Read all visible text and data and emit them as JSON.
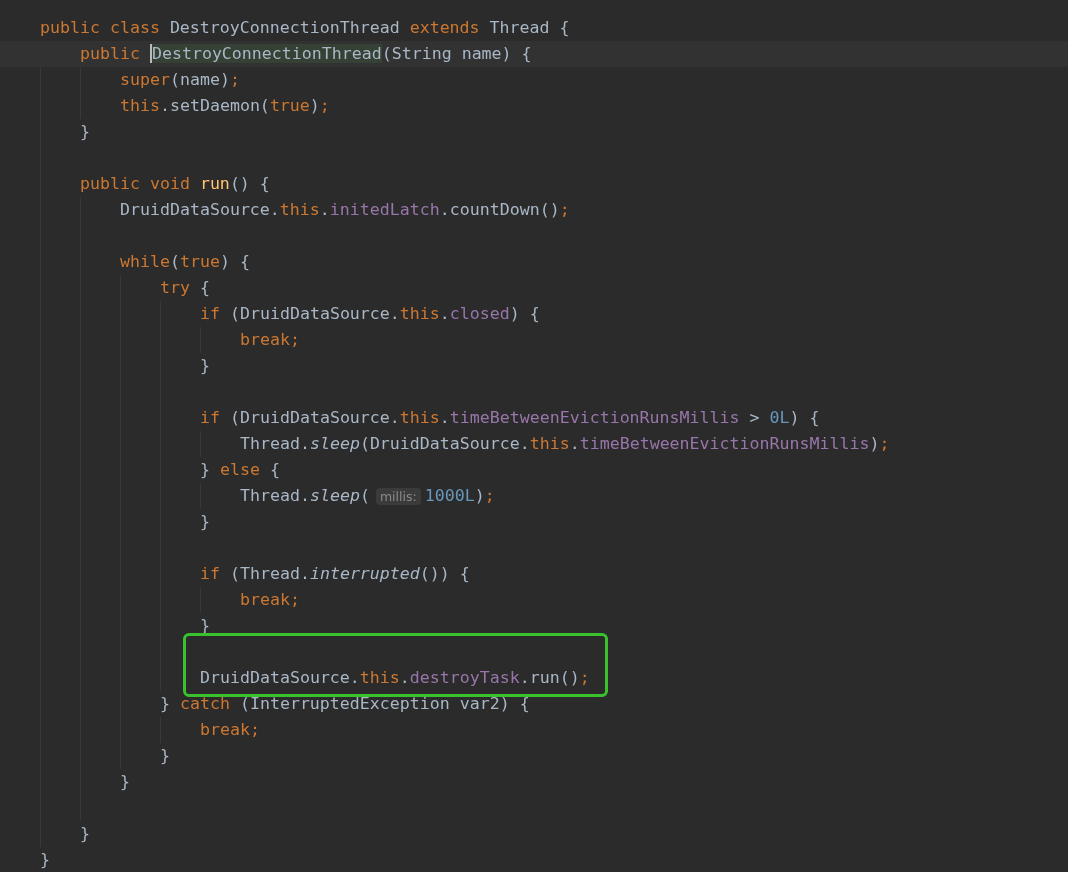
{
  "lines": [
    {
      "kind": "code",
      "tokens": [
        {
          "text": "public class ",
          "kind": "keyword"
        },
        {
          "text": "DestroyConnectionThread ",
          "kind": "plain"
        },
        {
          "text": "extends ",
          "kind": "keyword"
        },
        {
          "text": "Thread {",
          "kind": "plain"
        }
      ],
      "children": [
        {
          "kind": "code",
          "current": true,
          "tokens": [
            {
              "text": "public ",
              "kind": "keyword"
            },
            {
              "text": "DestroyConnectionThread",
              "kind": "declaration",
              "caret": true
            },
            {
              "text": "(String name) {",
              "kind": "plain"
            }
          ],
          "children": [
            {
              "kind": "code",
              "tokens": [
                {
                  "text": "super",
                  "kind": "keyword"
                },
                {
                  "text": "(name)",
                  "kind": "plain"
                },
                {
                  "text": ";",
                  "kind": "keyword"
                }
              ]
            },
            {
              "kind": "code",
              "tokens": [
                {
                  "text": "this",
                  "kind": "keyword"
                },
                {
                  "text": ".setDaemon(",
                  "kind": "plain"
                },
                {
                  "text": "true",
                  "kind": "keyword"
                },
                {
                  "text": ")",
                  "kind": "plain"
                },
                {
                  "text": ";",
                  "kind": "keyword"
                }
              ]
            }
          ]
        },
        {
          "kind": "code",
          "tokens": [
            {
              "text": "}",
              "kind": "plain"
            }
          ]
        },
        {
          "kind": "blank"
        },
        {
          "kind": "code",
          "tokens": [
            {
              "text": "public void ",
              "kind": "keyword"
            },
            {
              "text": "run",
              "kind": "method"
            },
            {
              "text": "() {",
              "kind": "plain"
            }
          ],
          "children": [
            {
              "kind": "code",
              "tokens": [
                {
                  "text": "DruidDataSource.",
                  "kind": "plain"
                },
                {
                  "text": "this",
                  "kind": "keyword"
                },
                {
                  "text": ".",
                  "kind": "plain"
                },
                {
                  "text": "initedLatch",
                  "kind": "field"
                },
                {
                  "text": ".countDown()",
                  "kind": "plain"
                },
                {
                  "text": ";",
                  "kind": "keyword"
                }
              ]
            },
            {
              "kind": "blank"
            },
            {
              "kind": "code",
              "tokens": [
                {
                  "text": "while",
                  "kind": "keyword"
                },
                {
                  "text": "(",
                  "kind": "plain"
                },
                {
                  "text": "true",
                  "kind": "keyword"
                },
                {
                  "text": ") {",
                  "kind": "plain"
                }
              ],
              "children": [
                {
                  "kind": "code",
                  "tokens": [
                    {
                      "text": "try ",
                      "kind": "keyword"
                    },
                    {
                      "text": "{",
                      "kind": "plain"
                    }
                  ],
                  "children": [
                    {
                      "kind": "code",
                      "tokens": [
                        {
                          "text": "if ",
                          "kind": "keyword"
                        },
                        {
                          "text": "(DruidDataSource.",
                          "kind": "plain"
                        },
                        {
                          "text": "this",
                          "kind": "keyword"
                        },
                        {
                          "text": ".",
                          "kind": "plain"
                        },
                        {
                          "text": "closed",
                          "kind": "field"
                        },
                        {
                          "text": ") {",
                          "kind": "plain"
                        }
                      ],
                      "children": [
                        {
                          "kind": "code",
                          "tokens": [
                            {
                              "text": "break;",
                              "kind": "keyword"
                            }
                          ]
                        }
                      ]
                    },
                    {
                      "kind": "code",
                      "tokens": [
                        {
                          "text": "}",
                          "kind": "plain"
                        }
                      ]
                    },
                    {
                      "kind": "blank"
                    },
                    {
                      "kind": "code",
                      "tokens": [
                        {
                          "text": "if ",
                          "kind": "keyword"
                        },
                        {
                          "text": "(DruidDataSource.",
                          "kind": "plain"
                        },
                        {
                          "text": "this",
                          "kind": "keyword"
                        },
                        {
                          "text": ".",
                          "kind": "plain"
                        },
                        {
                          "text": "timeBetweenEvictionRunsMillis",
                          "kind": "field"
                        },
                        {
                          "text": " > ",
                          "kind": "plain"
                        },
                        {
                          "text": "0L",
                          "kind": "number"
                        },
                        {
                          "text": ") {",
                          "kind": "plain"
                        }
                      ],
                      "children": [
                        {
                          "kind": "code",
                          "tokens": [
                            {
                              "text": "Thread.",
                              "kind": "plain"
                            },
                            {
                              "text": "sleep",
                              "kind": "static"
                            },
                            {
                              "text": "(DruidDataSource.",
                              "kind": "plain"
                            },
                            {
                              "text": "this",
                              "kind": "keyword"
                            },
                            {
                              "text": ".",
                              "kind": "plain"
                            },
                            {
                              "text": "timeBetweenEvictionRunsMillis",
                              "kind": "field"
                            },
                            {
                              "text": ")",
                              "kind": "plain"
                            },
                            {
                              "text": ";",
                              "kind": "keyword"
                            }
                          ]
                        }
                      ]
                    },
                    {
                      "kind": "code",
                      "tokens": [
                        {
                          "text": "} ",
                          "kind": "plain"
                        },
                        {
                          "text": "else ",
                          "kind": "keyword"
                        },
                        {
                          "text": "{",
                          "kind": "plain"
                        }
                      ],
                      "children": [
                        {
                          "kind": "code",
                          "tokens": [
                            {
                              "text": "Thread.",
                              "kind": "plain"
                            },
                            {
                              "text": "sleep",
                              "kind": "static"
                            },
                            {
                              "text": "(",
                              "kind": "plain"
                            },
                            {
                              "text": "millis:",
                              "kind": "hint"
                            },
                            {
                              "text": "1000L",
                              "kind": "number"
                            },
                            {
                              "text": ")",
                              "kind": "plain"
                            },
                            {
                              "text": ";",
                              "kind": "keyword"
                            }
                          ]
                        }
                      ]
                    },
                    {
                      "kind": "code",
                      "tokens": [
                        {
                          "text": "}",
                          "kind": "plain"
                        }
                      ]
                    },
                    {
                      "kind": "blank"
                    },
                    {
                      "kind": "code",
                      "tokens": [
                        {
                          "text": "if ",
                          "kind": "keyword"
                        },
                        {
                          "text": "(Thread.",
                          "kind": "plain"
                        },
                        {
                          "text": "interrupted",
                          "kind": "static"
                        },
                        {
                          "text": "()) {",
                          "kind": "plain"
                        }
                      ],
                      "children": [
                        {
                          "kind": "code",
                          "tokens": [
                            {
                              "text": "break;",
                              "kind": "keyword"
                            }
                          ]
                        }
                      ]
                    },
                    {
                      "kind": "code",
                      "tokens": [
                        {
                          "text": "}",
                          "kind": "plain"
                        }
                      ]
                    },
                    {
                      "kind": "blank"
                    },
                    {
                      "kind": "code",
                      "annotated": true,
                      "tokens": [
                        {
                          "text": "DruidDataSource.",
                          "kind": "plain"
                        },
                        {
                          "text": "this",
                          "kind": "keyword"
                        },
                        {
                          "text": ".",
                          "kind": "plain"
                        },
                        {
                          "text": "destroyTask",
                          "kind": "field"
                        },
                        {
                          "text": ".run()",
                          "kind": "plain"
                        },
                        {
                          "text": ";",
                          "kind": "keyword"
                        }
                      ]
                    }
                  ]
                },
                {
                  "kind": "code",
                  "tokens": [
                    {
                      "text": "} ",
                      "kind": "plain"
                    },
                    {
                      "text": "catch ",
                      "kind": "keyword"
                    },
                    {
                      "text": "(InterruptedException var2) {",
                      "kind": "plain"
                    }
                  ],
                  "children": [
                    {
                      "kind": "code",
                      "tokens": [
                        {
                          "text": "break;",
                          "kind": "keyword"
                        }
                      ]
                    }
                  ]
                },
                {
                  "kind": "code",
                  "tokens": [
                    {
                      "text": "}",
                      "kind": "plain"
                    }
                  ]
                }
              ]
            },
            {
              "kind": "code",
              "tokens": [
                {
                  "text": "}",
                  "kind": "plain"
                }
              ]
            },
            {
              "kind": "blank"
            }
          ]
        },
        {
          "kind": "code",
          "tokens": [
            {
              "text": "}",
              "kind": "plain"
            }
          ]
        }
      ]
    },
    {
      "kind": "code",
      "tokens": [
        {
          "text": "}",
          "kind": "plain"
        }
      ]
    }
  ]
}
